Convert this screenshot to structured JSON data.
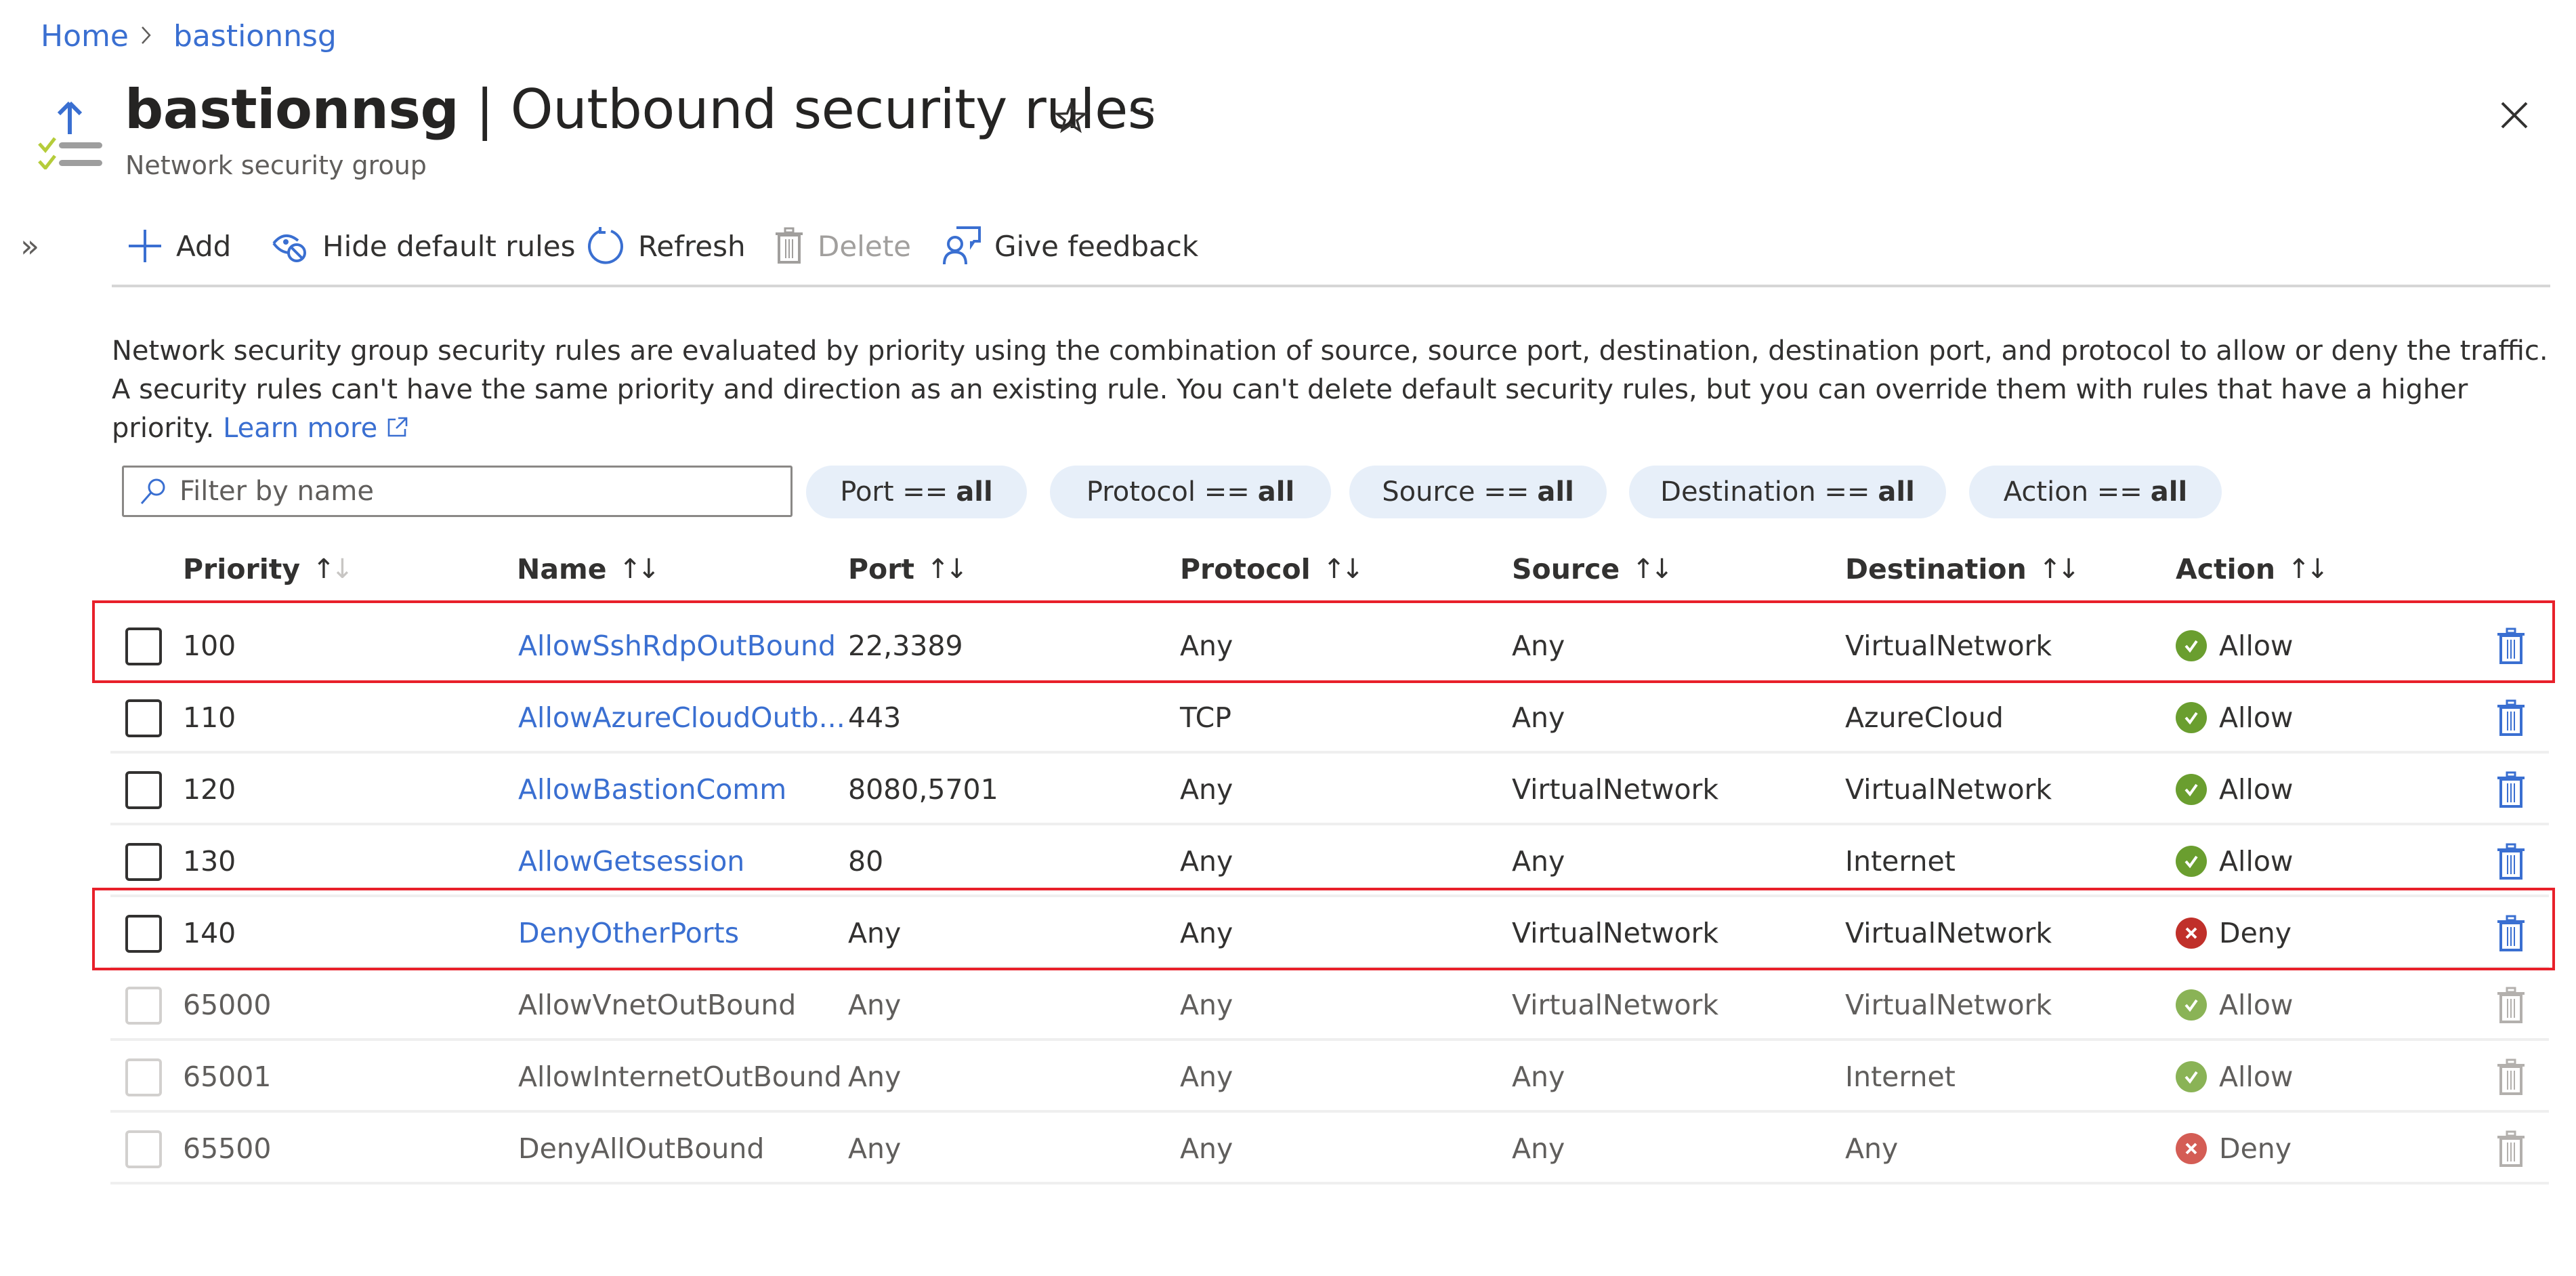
{
  "breadcrumb": {
    "items": [
      "Home",
      "bastionnsg"
    ],
    "separator": ">"
  },
  "header": {
    "resource_name": "bastionnsg",
    "title_separator": " | ",
    "page_name": "Outbound security rules",
    "subtitle": "Network security group",
    "favorite_icon": "star-icon",
    "more_icon": "ellipsis-icon",
    "more_label": "···",
    "close_icon": "close-icon"
  },
  "sidebar": {
    "expand_icon": "chevron-double-right-icon",
    "expand_label": "»"
  },
  "toolbar": {
    "add": "Add",
    "hide_default_rules": "Hide default rules",
    "refresh": "Refresh",
    "delete": "Delete",
    "give_feedback": "Give feedback"
  },
  "description": {
    "text": "Network security group security rules are evaluated by priority using the combination of source, source port, destination, destination port, and protocol to allow or deny the traffic. A security rules can't have the same priority and direction as an existing rule. You can't delete default security rules, but you can override them with rules that have a higher priority.",
    "learn_more": "Learn more"
  },
  "filters": {
    "search_placeholder": "Filter by name",
    "search_value": "",
    "pills": [
      {
        "key": "Port ==",
        "value": "all"
      },
      {
        "key": "Protocol ==",
        "value": "all"
      },
      {
        "key": "Source ==",
        "value": "all"
      },
      {
        "key": "Destination ==",
        "value": "all"
      },
      {
        "key": "Action ==",
        "value": "all"
      }
    ]
  },
  "table": {
    "columns": [
      "Priority",
      "Name",
      "Port",
      "Protocol",
      "Source",
      "Destination",
      "Action"
    ],
    "sort_icon": "↑↓",
    "rows": [
      {
        "priority": "100",
        "name": "AllowSshRdpOutBound",
        "port": "22,3389",
        "protocol": "Any",
        "source": "Any",
        "destination": "VirtualNetwork",
        "action": "Allow",
        "default": false,
        "highlighted": true
      },
      {
        "priority": "110",
        "name": "AllowAzureCloudOutb...",
        "port": "443",
        "protocol": "TCP",
        "source": "Any",
        "destination": "AzureCloud",
        "action": "Allow",
        "default": false,
        "highlighted": false
      },
      {
        "priority": "120",
        "name": "AllowBastionComm",
        "port": "8080,5701",
        "protocol": "Any",
        "source": "VirtualNetwork",
        "destination": "VirtualNetwork",
        "action": "Allow",
        "default": false,
        "highlighted": false
      },
      {
        "priority": "130",
        "name": "AllowGetsession",
        "port": "80",
        "protocol": "Any",
        "source": "Any",
        "destination": "Internet",
        "action": "Allow",
        "default": false,
        "highlighted": false
      },
      {
        "priority": "140",
        "name": "DenyOtherPorts",
        "port": "Any",
        "protocol": "Any",
        "source": "VirtualNetwork",
        "destination": "VirtualNetwork",
        "action": "Deny",
        "default": false,
        "highlighted": true
      },
      {
        "priority": "65000",
        "name": "AllowVnetOutBound",
        "port": "Any",
        "protocol": "Any",
        "source": "VirtualNetwork",
        "destination": "VirtualNetwork",
        "action": "Allow",
        "default": true,
        "highlighted": false
      },
      {
        "priority": "65001",
        "name": "AllowInternetOutBound",
        "port": "Any",
        "protocol": "Any",
        "source": "Any",
        "destination": "Internet",
        "action": "Allow",
        "default": true,
        "highlighted": false
      },
      {
        "priority": "65500",
        "name": "DenyAllOutBound",
        "port": "Any",
        "protocol": "Any",
        "source": "Any",
        "destination": "Any",
        "action": "Deny",
        "default": true,
        "highlighted": false
      }
    ]
  },
  "colors": {
    "accent": "#3a6fd1",
    "allow": "#6a9e2f",
    "allow_default": "#8ab356",
    "deny": "#c0302a",
    "deny_default": "#d45d55",
    "highlight": "#e8202a",
    "pill_bg": "#e7eff9"
  }
}
